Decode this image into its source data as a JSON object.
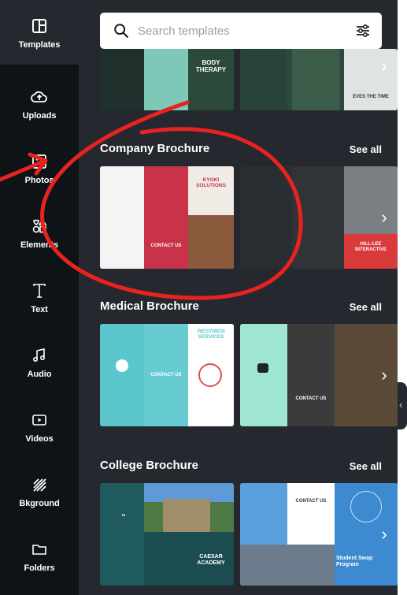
{
  "sidebar": {
    "items": [
      {
        "label": "Templates",
        "icon": "templates-icon",
        "active": true
      },
      {
        "label": "Uploads",
        "icon": "uploads-icon"
      },
      {
        "label": "Photos",
        "icon": "photos-icon"
      },
      {
        "label": "Elements",
        "icon": "elements-icon"
      },
      {
        "label": "Text",
        "icon": "text-icon"
      },
      {
        "label": "Audio",
        "icon": "audio-icon"
      },
      {
        "label": "Videos",
        "icon": "videos-icon"
      },
      {
        "label": "Bkground",
        "icon": "background-icon"
      },
      {
        "label": "Folders",
        "icon": "folders-icon"
      }
    ]
  },
  "search": {
    "placeholder": "Search templates",
    "value": ""
  },
  "sections": [
    {
      "title": "",
      "see_all": "",
      "thumbs": [
        {
          "text": "BODY THERAPY"
        },
        {
          "text": "EVES THE TIME"
        }
      ]
    },
    {
      "title": "Company Brochure",
      "see_all": "See all",
      "thumbs": [
        {
          "text": "KYOKI SOLUTIONS",
          "text2": "CONTACT US"
        },
        {
          "text": "HILL-LEE INTERACTIVE"
        }
      ]
    },
    {
      "title": "Medical Brochure",
      "see_all": "See all",
      "thumbs": [
        {
          "text": "WESTMEDI SERVICES",
          "text2": "CONTACT US"
        },
        {
          "text": "CONTACT US"
        }
      ]
    },
    {
      "title": "College Brochure",
      "see_all": "See all",
      "thumbs": [
        {
          "text": "CAESAR ACADEMY"
        },
        {
          "text": "Student Swap Program",
          "text2": "CONTACT US"
        }
      ]
    }
  ],
  "colors": {
    "rail": "#0e1318",
    "panel": "#25282f",
    "annotation": "#e8231f",
    "company_red": "#c8334a",
    "medical_teal": "#5cc6cd",
    "college_green": "#1f5a5e",
    "college_blue": "#5aa0dc"
  }
}
